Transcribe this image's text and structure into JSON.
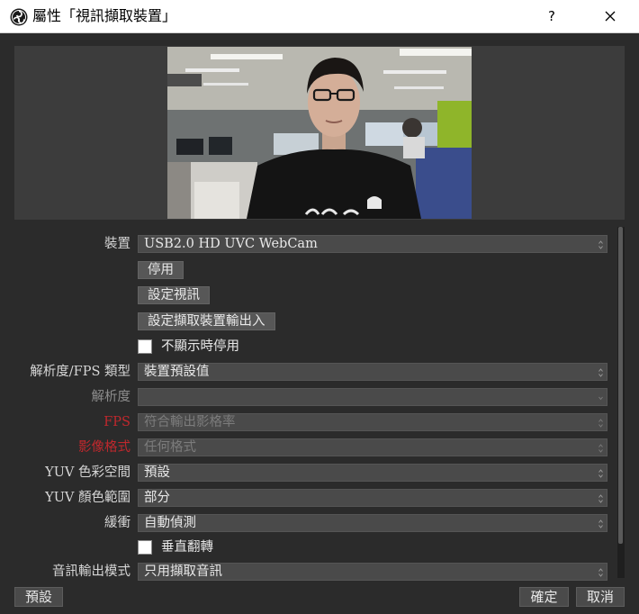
{
  "window": {
    "title": "屬性「視訊擷取裝置」",
    "help_label": "?",
    "app_icon": "obs-logo-icon",
    "close_icon": "close-icon"
  },
  "preview": {
    "image": "webcam-preview-person-in-office"
  },
  "properties": {
    "device": {
      "label": "裝置",
      "value": "USB2.0 HD UVC WebCam"
    },
    "deactivate_button": "停用",
    "configure_video_button": "設定視訊",
    "configure_crossbar_button": "設定擷取裝置輸出入",
    "deactivate_when_hidden": {
      "label": "不顯示時停用",
      "checked": false
    },
    "resolution_fps_type": {
      "label": "解析度/FPS 類型",
      "value": "裝置預設值"
    },
    "resolution": {
      "label": "解析度",
      "value": ""
    },
    "fps": {
      "label": "FPS",
      "value": "符合輸出影格率"
    },
    "video_format": {
      "label": "影像格式",
      "value": "任何格式"
    },
    "yuv_color_space": {
      "label": "YUV 色彩空間",
      "value": "預設"
    },
    "yuv_color_range": {
      "label": "YUV 顏色範圍",
      "value": "部分"
    },
    "buffering": {
      "label": "緩衝",
      "value": "自動偵測"
    },
    "flip_vertically": {
      "label": "垂直翻轉",
      "checked": false
    },
    "audio_output_mode": {
      "label": "音訊輸出模式",
      "value": "只用擷取音訊"
    }
  },
  "footer": {
    "defaults_button": "預設",
    "ok_button": "確定",
    "cancel_button": "取消"
  },
  "colors": {
    "background": "#2b2b2b",
    "input": "#4a4a4a",
    "button": "#575757",
    "warning_label": "#c0282d",
    "text": "#e8e8e8"
  }
}
